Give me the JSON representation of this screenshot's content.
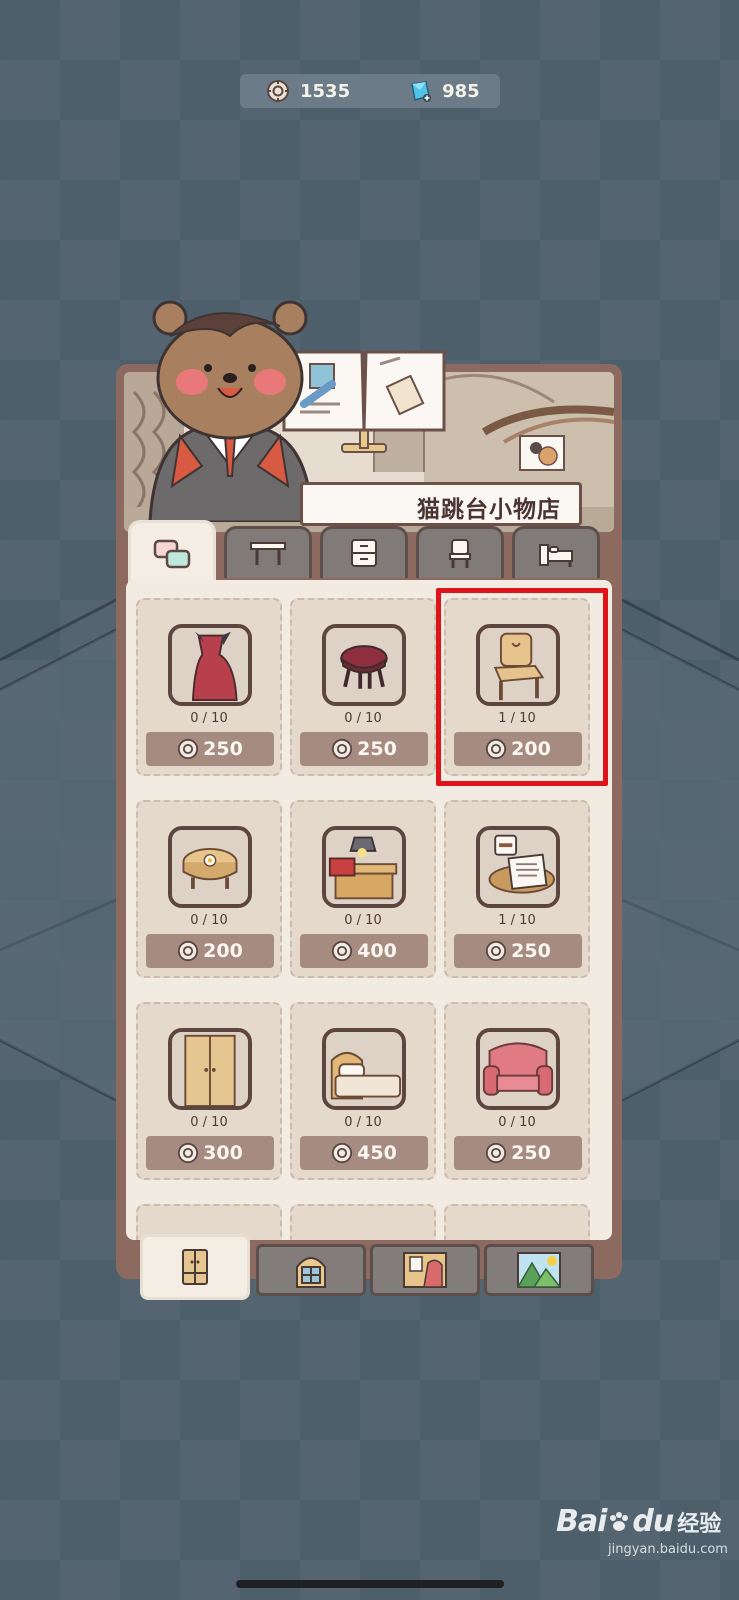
{
  "currency": {
    "coins": "1535",
    "gems": "985"
  },
  "shop": {
    "title": "猫跳台小物店"
  },
  "category_tabs": [
    {
      "icon": "chat-bubbles-icon",
      "active": true
    },
    {
      "icon": "table-icon",
      "active": false
    },
    {
      "icon": "cabinet-icon",
      "active": false
    },
    {
      "icon": "chair-icon",
      "active": false
    },
    {
      "icon": "bed-icon",
      "active": false
    }
  ],
  "items": [
    {
      "icon": "red-dress-icon",
      "count": "0 / 10",
      "price": "250"
    },
    {
      "icon": "red-stool-icon",
      "count": "0 / 10",
      "price": "250"
    },
    {
      "icon": "wooden-chair-icon",
      "count": "1 / 10",
      "price": "200"
    },
    {
      "icon": "round-flower-table-icon",
      "count": "0 / 10",
      "price": "200"
    },
    {
      "icon": "lamp-nightstand-icon",
      "count": "0 / 10",
      "price": "400"
    },
    {
      "icon": "tea-table-icon",
      "count": "1 / 10",
      "price": "250"
    },
    {
      "icon": "wardrobe-icon",
      "count": "0 / 10",
      "price": "300"
    },
    {
      "icon": "bed-icon",
      "count": "0 / 10",
      "price": "450"
    },
    {
      "icon": "pink-sofa-icon",
      "count": "0 / 10",
      "price": "250"
    }
  ],
  "bottom_tabs": [
    {
      "icon": "wardrobe-icon",
      "active": true
    },
    {
      "icon": "window-icon",
      "active": false
    },
    {
      "icon": "wall-decor-icon",
      "active": false
    },
    {
      "icon": "landscape-icon",
      "active": false
    }
  ],
  "watermark": {
    "brand": "Bai",
    "brand2": "du",
    "sub": "经验",
    "url": "jingyan.baidu.com"
  },
  "colors": {
    "background": "#4e5f6c",
    "panel_frame": "#8d6a60",
    "price_pill": "#a58b80",
    "highlight": "#e0131a"
  }
}
